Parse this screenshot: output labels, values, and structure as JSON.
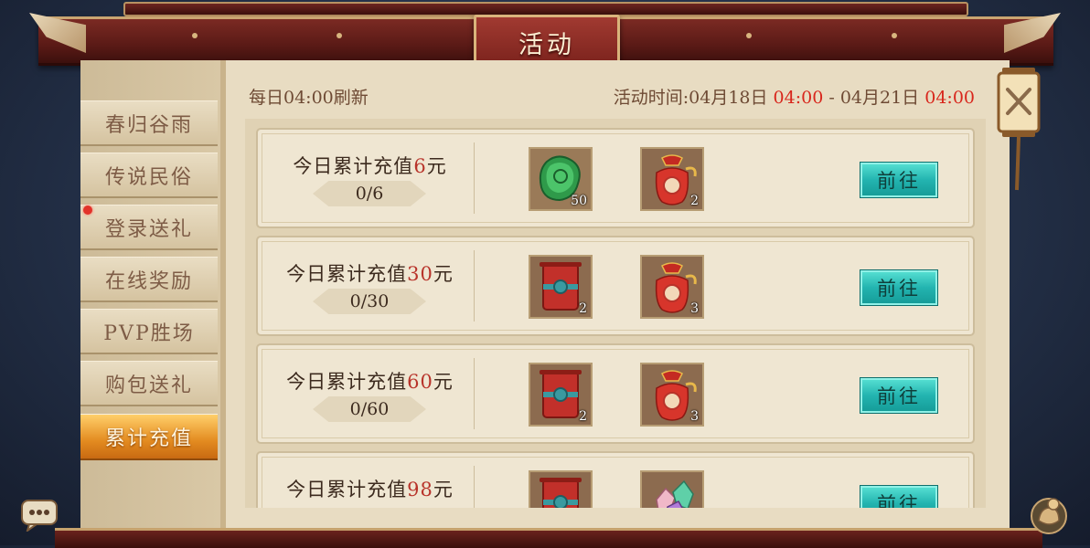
{
  "title": "活动",
  "refresh_note": "每日04:00刷新",
  "activity_time": {
    "label": "活动时间:",
    "start_date": "04月18日",
    "start_time": "04:00",
    "separator": "-",
    "end_date": "04月21日",
    "end_time": "04:00"
  },
  "sidebar": {
    "items": [
      {
        "label": "春归谷雨",
        "active": false
      },
      {
        "label": "传说民俗",
        "active": false
      },
      {
        "label": "登录送礼",
        "active": false,
        "badge": true
      },
      {
        "label": "在线奖励",
        "active": false
      },
      {
        "label": "PVP胜场",
        "active": false
      },
      {
        "label": "购包送礼",
        "active": false
      },
      {
        "label": "累计充值",
        "active": true
      }
    ]
  },
  "rows": [
    {
      "prefix": "今日累计充值",
      "amount": "6",
      "suffix": "元",
      "progress": "0/6",
      "rewards": [
        {
          "icon": "jade-token-icon",
          "count": "50"
        },
        {
          "icon": "red-lucky-bag-icon",
          "count": "2"
        }
      ],
      "button": "前往"
    },
    {
      "prefix": "今日累计充值",
      "amount": "30",
      "suffix": "元",
      "progress": "0/30",
      "rewards": [
        {
          "icon": "red-scroll-icon",
          "count": "2"
        },
        {
          "icon": "red-lucky-bag-icon",
          "count": "3"
        }
      ],
      "button": "前往"
    },
    {
      "prefix": "今日累计充值",
      "amount": "60",
      "suffix": "元",
      "progress": "0/60",
      "rewards": [
        {
          "icon": "red-scroll-icon",
          "count": "2"
        },
        {
          "icon": "red-lucky-bag-icon",
          "count": "3"
        }
      ],
      "button": "前往"
    },
    {
      "prefix": "今日累计充值",
      "amount": "98",
      "suffix": "元",
      "progress": "",
      "rewards": [
        {
          "icon": "red-scroll-icon",
          "count": ""
        },
        {
          "icon": "gem-cluster-icon",
          "count": ""
        }
      ],
      "button": "前往"
    }
  ],
  "colors": {
    "accent_red": "#d8261c",
    "amount_red": "#b8332a",
    "go_button": "#23b4b0",
    "active_tab": "#e38b20"
  }
}
